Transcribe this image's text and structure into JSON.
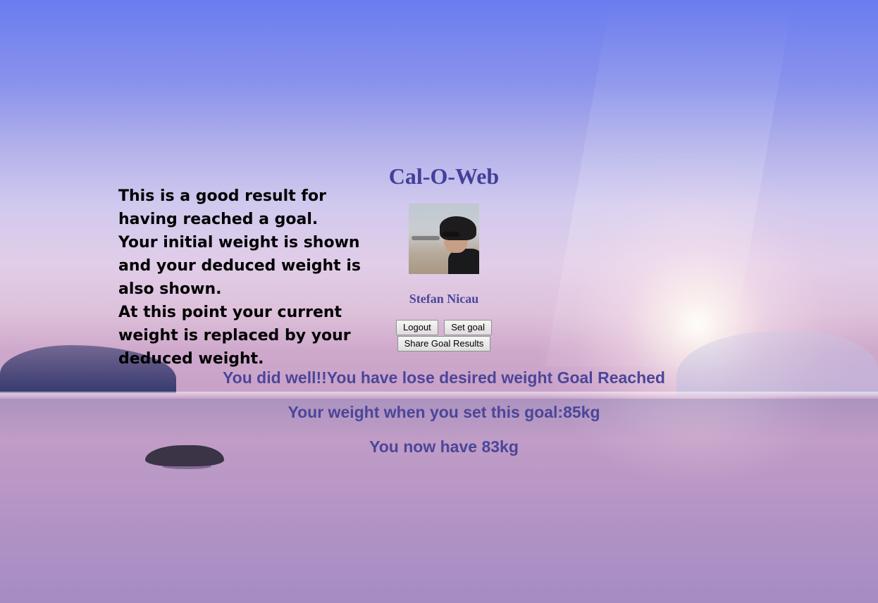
{
  "app": {
    "title": "Cal-O-Web"
  },
  "description": {
    "lines": [
      "This is a good result for having reached a goal.",
      "Your initial weight is shown and your deduced weight is also shown.",
      "At this point your current weight is replaced by your deduced weight."
    ]
  },
  "user": {
    "name": "Stefan Nicau"
  },
  "buttons": {
    "logout": "Logout",
    "set_goal": "Set goal",
    "share_results": "Share Goal Results"
  },
  "results": {
    "goal_message": "You did well!!You have lose desired weight Goal Reached",
    "initial_weight": "Your weight when you set this goal:85kg",
    "current_weight": "You now have 83kg"
  },
  "colors": {
    "accent": "#4b4699",
    "title": "#43409a",
    "body_text": "#000000"
  }
}
